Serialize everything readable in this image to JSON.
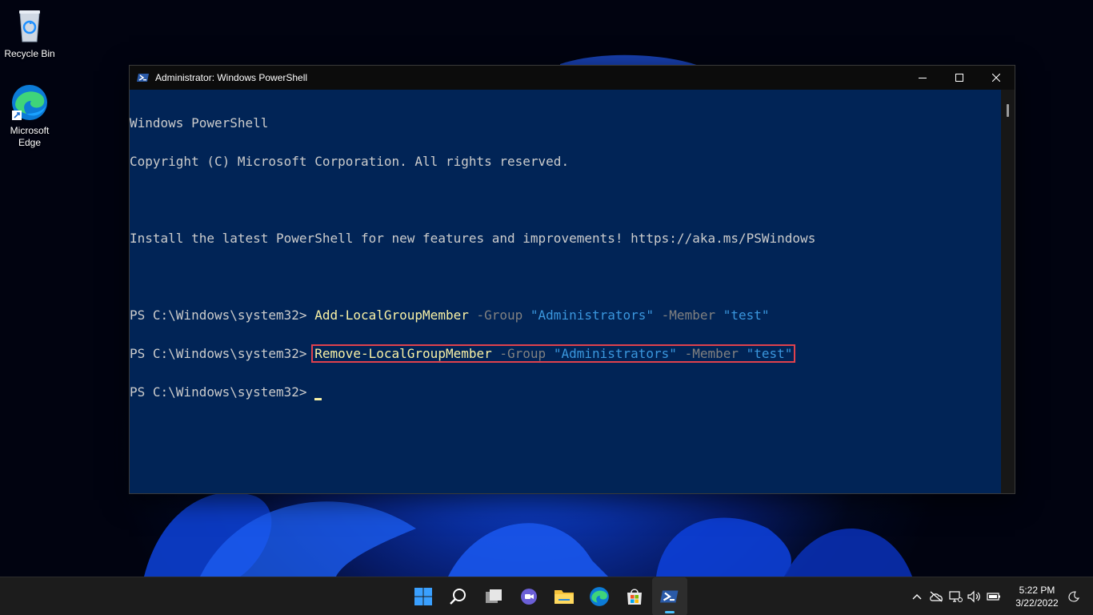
{
  "desktop": {
    "icons": [
      {
        "label": "Recycle Bin",
        "icon": "recycle-bin-icon"
      },
      {
        "label": "Microsoft Edge",
        "icon": "edge-icon"
      }
    ]
  },
  "window": {
    "title": "Administrator: Windows PowerShell",
    "controls": {
      "minimize": "minimize-icon",
      "maximize": "maximize-icon",
      "close": "close-icon"
    }
  },
  "console": {
    "line1": "Windows PowerShell",
    "line2": "Copyright (C) Microsoft Corporation. All rights reserved.",
    "line3": "Install the latest PowerShell for new features and improvements! https://aka.ms/PSWindows",
    "prompt": "PS C:\\Windows\\system32> ",
    "cmd1": {
      "cmdlet": "Add-LocalGroupMember",
      "p1": " -Group ",
      "v1": "\"Administrators\"",
      "p2": " -Member ",
      "v2": "\"test\""
    },
    "cmd2": {
      "cmdlet": "Remove-LocalGroupMember",
      "p1": " -Group ",
      "v1": "\"Administrators\"",
      "p2": " -Member ",
      "v2": "\"test\""
    }
  },
  "taskbar": {
    "apps": [
      "start-icon",
      "search-icon",
      "task-view-icon",
      "chat-icon",
      "file-explorer-icon",
      "edge-icon",
      "store-icon",
      "powershell-icon"
    ],
    "active": "powershell-icon",
    "tray": [
      "chevron-up-icon",
      "onedrive-icon",
      "network-icon",
      "volume-icon",
      "battery-icon"
    ],
    "time": "5:22 PM",
    "date": "3/22/2022"
  },
  "colors": {
    "console_bg": "#012456",
    "cmdlet": "#f9f1a5",
    "parameter": "#808080",
    "string": "#3a96dd",
    "highlight_box": "#e0414d"
  }
}
